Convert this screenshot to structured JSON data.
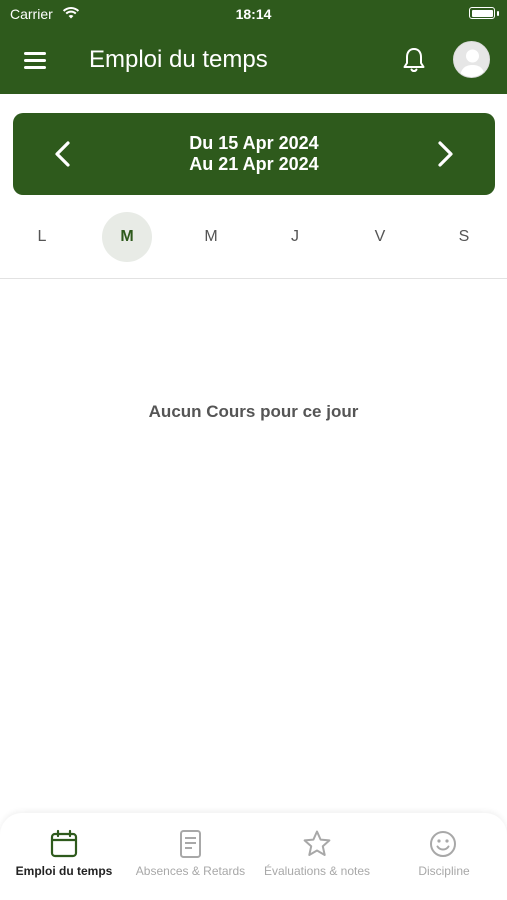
{
  "status_bar": {
    "carrier": "Carrier",
    "time": "18:14"
  },
  "app_bar": {
    "title": "Emploi du temps",
    "menu_icon": "hamburger-menu-icon",
    "notification_icon": "bell-icon",
    "avatar_icon": "user-avatar"
  },
  "week": {
    "from": "Du 15 Apr 2024",
    "to": "Au 21 Apr 2024"
  },
  "days": [
    {
      "label": "L",
      "selected": false
    },
    {
      "label": "M",
      "selected": true
    },
    {
      "label": "M",
      "selected": false
    },
    {
      "label": "J",
      "selected": false
    },
    {
      "label": "V",
      "selected": false
    },
    {
      "label": "S",
      "selected": false
    }
  ],
  "empty_message": "Aucun Cours pour ce jour",
  "tabs": [
    {
      "label": "Emploi du temps",
      "icon": "calendar-icon",
      "active": true
    },
    {
      "label": "Absences & Retards",
      "icon": "document-icon",
      "active": false
    },
    {
      "label": "Évaluations & notes",
      "icon": "star-icon",
      "active": false
    },
    {
      "label": "Discipline",
      "icon": "smiley-icon",
      "active": false
    }
  ],
  "colors": {
    "primary": "#2e5a1c",
    "selected_day_bg": "#e8ebe6",
    "inactive_tab": "#a8a8a8"
  }
}
